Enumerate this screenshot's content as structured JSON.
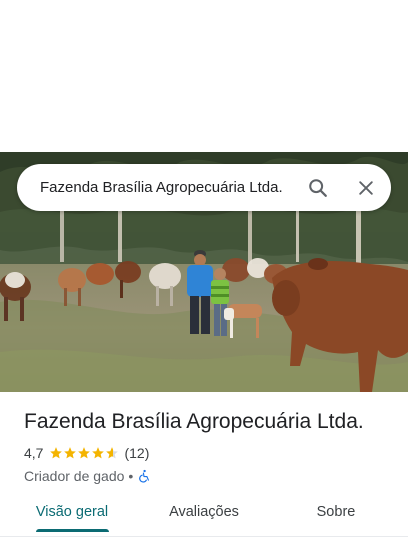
{
  "search": {
    "query": "Fazenda Brasília Agropecuária Ltda."
  },
  "place": {
    "name": "Fazenda Brasília Agropecuária Ltda.",
    "rating": "4,7",
    "rating_value": 4.7,
    "review_count": "(12)",
    "category": "Criador de gado",
    "separator": "•",
    "accessibility_icon": "wheelchair-icon"
  },
  "tabs": [
    {
      "label": "Visão geral",
      "active": true
    },
    {
      "label": "Avaliações",
      "active": false
    },
    {
      "label": "Sobre",
      "active": false
    }
  ],
  "colors": {
    "accent": "#0b6b73",
    "star": "#f4b400",
    "accessibility": "#1a73e8"
  },
  "icons": {
    "search": "search-icon",
    "close": "close-icon"
  }
}
